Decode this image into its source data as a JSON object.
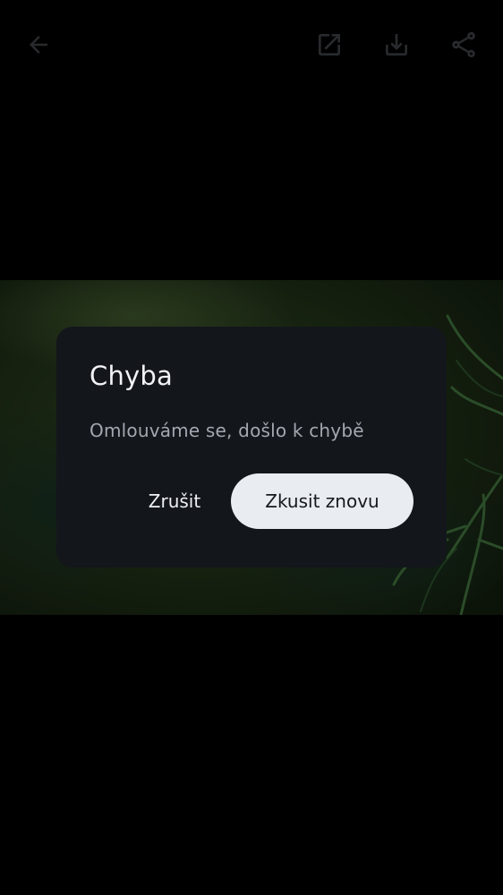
{
  "toolbar": {
    "back_icon": "arrow-back-icon",
    "open_icon": "open-in-new-icon",
    "download_icon": "download-icon",
    "share_icon": "share-icon",
    "icon_color": "#4a4d52"
  },
  "image": {
    "subject": "green plant",
    "dominant_color": "#2a3d1c"
  },
  "dialog": {
    "title": "Chyba",
    "message": "Omlouváme se, došlo k chybě",
    "cancel_label": "Zrušit",
    "retry_label": "Zkusit znovu",
    "background": "#13161b",
    "primary_button_color": "#e9ecf1"
  }
}
